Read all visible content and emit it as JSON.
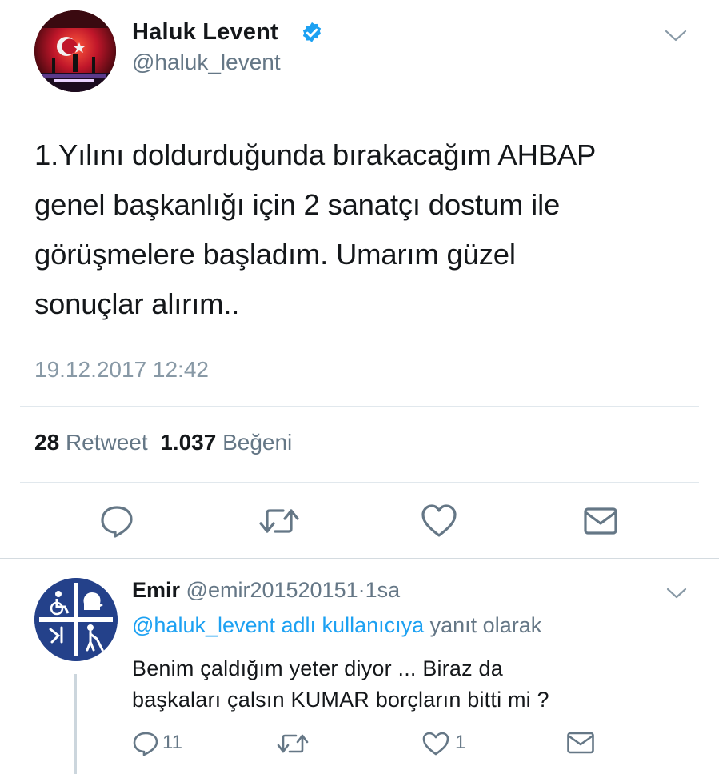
{
  "tweet": {
    "author_name": "Haluk Levent",
    "author_handle": "@haluk_levent",
    "text": "1.Yılını doldurduğunda bırakacağım AHBAP\ngenel başkanlığı için 2 sanatçı dostum ile\ngörüşmelere başladım. Umarım güzel\nsonuçlar alırım..",
    "timestamp": "19.12.2017 12:42",
    "retweet_count": "28",
    "retweet_label": "Retweet",
    "like_count": "1.037",
    "like_label": "Beğeni",
    "actions": [
      "reply-icon",
      "retweet-icon",
      "like-icon",
      "message-icon"
    ]
  },
  "reply": {
    "author_name": "Emir",
    "author_handle": "@emir201520151",
    "separator": "·",
    "time": "1sa",
    "context_link": "@haluk_levent adlı kullanıcıya",
    "context_suffix": "yanıt olarak",
    "text": "Benim çaldığım yeter diyor ... Biraz da\nbaşkaları çalsın KUMAR borçların bitti mi ?",
    "reply_count": "11",
    "like_count": "1",
    "actions": [
      "reply-icon",
      "retweet-icon",
      "like-icon",
      "message-icon"
    ]
  },
  "colors": {
    "verified": "#1da1f2",
    "link": "#1da1f2",
    "muted": "#657786",
    "icon": "#657786",
    "divider": "#e1e8ed",
    "reply_avatar_bg": "#24418a"
  }
}
